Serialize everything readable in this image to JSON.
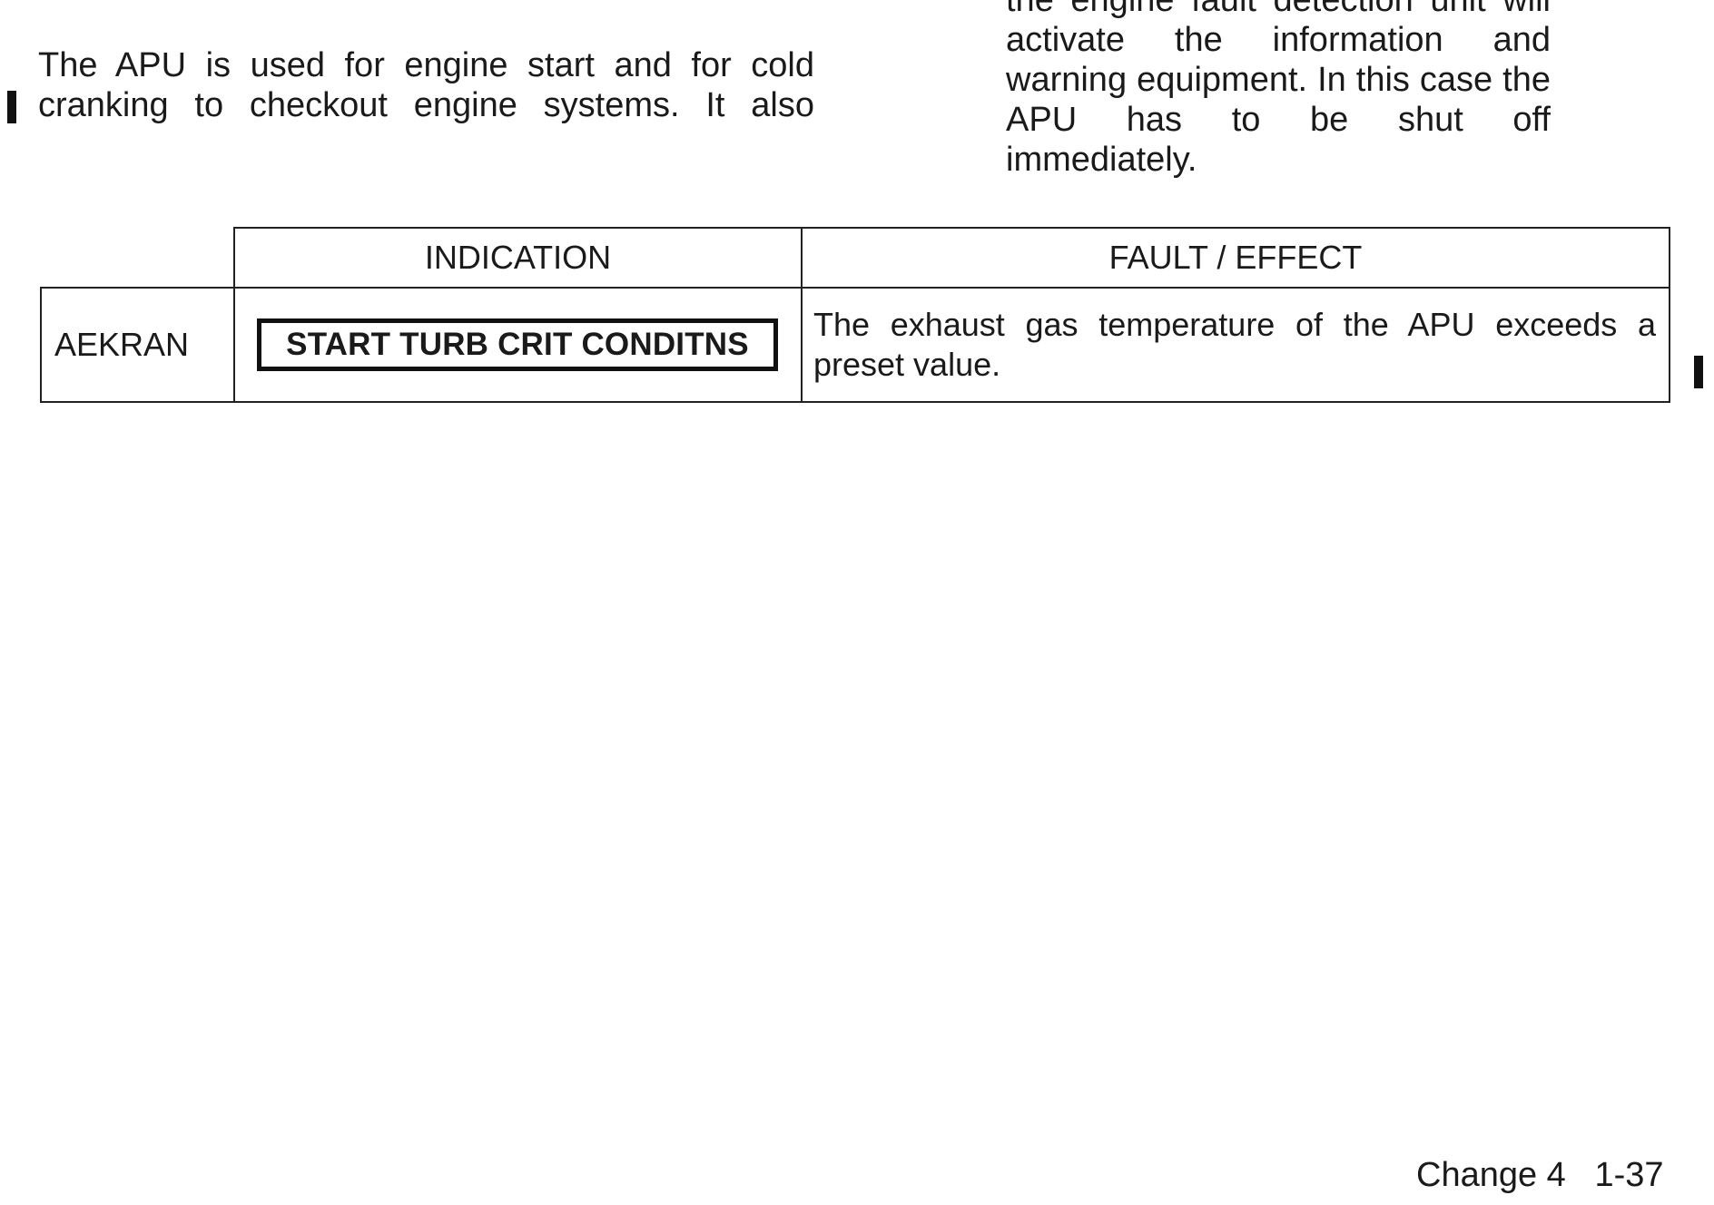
{
  "left_column": {
    "cut_line": "",
    "lines": [
      "The APU is used for engine start and for cold",
      "cranking to checkout engine systems. It also"
    ]
  },
  "right_column": {
    "lines": [
      "the engine fault detection unit will",
      "activate the information and",
      "warning equipment. In this case the",
      "APU has to be shut off immediately."
    ]
  },
  "table": {
    "headers": [
      "",
      "INDICATION",
      "FAULT / EFFECT"
    ],
    "rows": [
      {
        "system": "AEKRAN",
        "indication": "START TURB CRIT CONDITNS",
        "effect_lines": [
          "The exhaust gas temperature of the APU exceeds a",
          "preset value."
        ]
      }
    ]
  },
  "footer": {
    "change": "Change 4",
    "page": "1-37"
  }
}
